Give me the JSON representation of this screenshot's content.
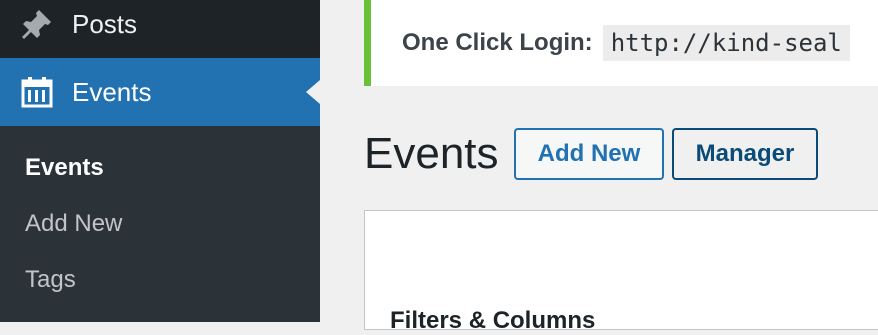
{
  "sidebar": {
    "menu": [
      {
        "label": "Posts",
        "icon": "pushpin-icon"
      },
      {
        "label": "Events",
        "icon": "calendar-icon",
        "active": true
      }
    ],
    "submenu": [
      {
        "label": "Events",
        "current": true
      },
      {
        "label": "Add New"
      },
      {
        "label": "Tags"
      }
    ]
  },
  "notice": {
    "label": "One Click Login:",
    "url": "http://kind-seal"
  },
  "page": {
    "title": "Events",
    "add_new_label": "Add New",
    "manager_label": "Manager"
  },
  "panel": {
    "heading": "Filters & Columns"
  },
  "colors": {
    "sidebar_bg": "#1d2327",
    "submenu_bg": "#2c3338",
    "active_blue": "#2271b1",
    "notice_border": "#68c137",
    "page_bg": "#f0f0f1"
  }
}
